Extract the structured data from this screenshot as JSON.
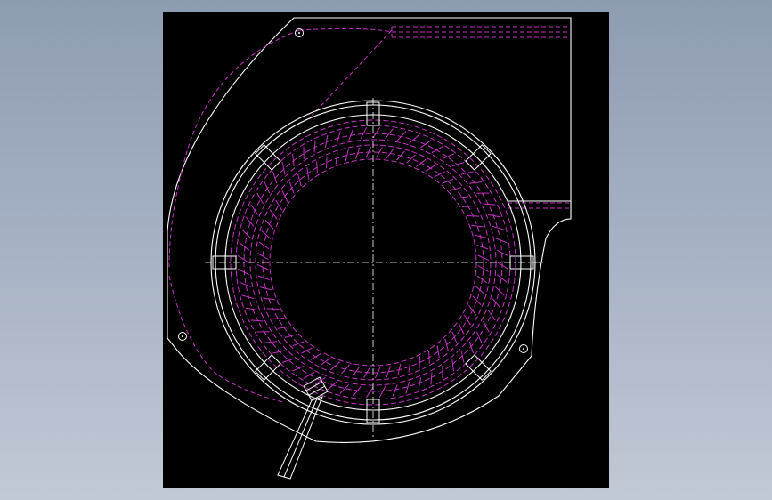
{
  "viewport": {
    "background": "#000000"
  },
  "colors": {
    "geometry": "#ffffff",
    "hidden": "#c832c8",
    "centerline": "#ffffff"
  },
  "drawing": {
    "subject": "blower-housing-with-fan-wheel",
    "visible_text": []
  }
}
